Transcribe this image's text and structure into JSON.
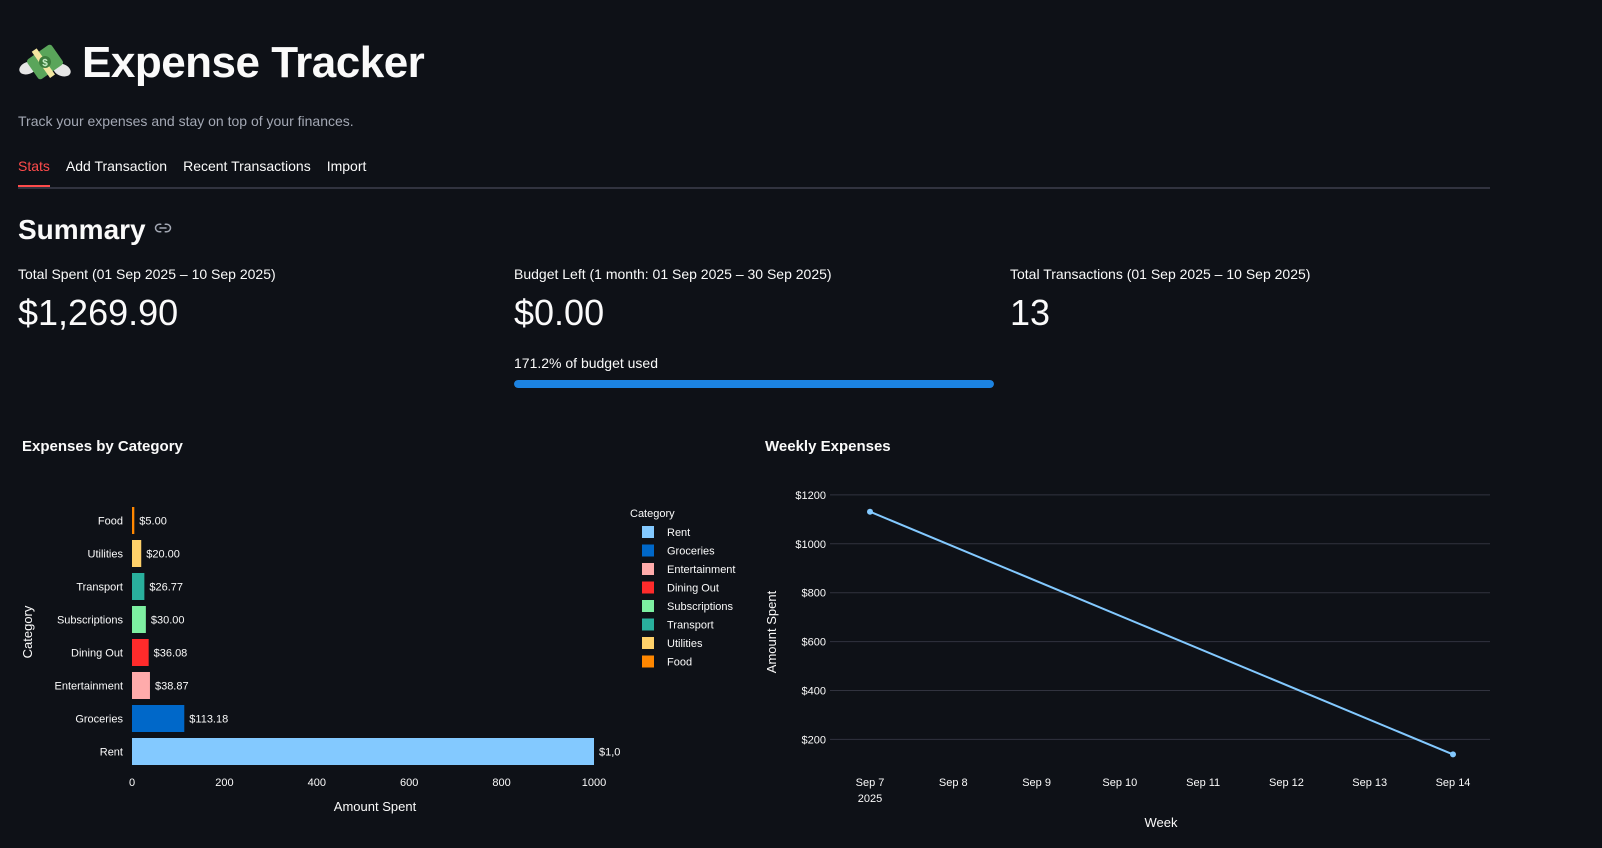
{
  "header": {
    "title": "Expense Tracker",
    "emoji": "money-with-wings-icon",
    "subtitle": "Track your expenses and stay on top of your finances."
  },
  "tabs": [
    {
      "label": "Stats",
      "active": true
    },
    {
      "label": "Add Transaction",
      "active": false
    },
    {
      "label": "Recent Transactions",
      "active": false
    },
    {
      "label": "Import",
      "active": false
    }
  ],
  "summary": {
    "heading": "Summary",
    "total_spent_label": "Total Spent (01 Sep 2025 – 10 Sep 2025)",
    "total_spent_value": "$1,269.90",
    "budget_left_label": "Budget Left (1 month: 01 Sep 2025 – 30 Sep 2025)",
    "budget_left_value": "$0.00",
    "budget_used_text": "171.2% of budget used",
    "budget_progress_fraction": 1.0,
    "total_transactions_label": "Total Transactions (01 Sep 2025 – 10 Sep 2025)",
    "total_transactions_value": "13"
  },
  "colors": {
    "accent": "#ff4b4b",
    "progress": "#1c83e1",
    "line": "#83c9ff"
  },
  "chart_data": [
    {
      "type": "bar",
      "orientation": "horizontal",
      "title": "Expenses by Category",
      "xlabel": "Amount Spent",
      "ylabel": "Category",
      "categories": [
        "Food",
        "Utilities",
        "Transport",
        "Subscriptions",
        "Dining Out",
        "Entertainment",
        "Groceries",
        "Rent"
      ],
      "values": [
        5.0,
        20.0,
        26.77,
        30.0,
        36.08,
        38.87,
        113.18,
        1000.0
      ],
      "data_labels": [
        "$5.00",
        "$20.00",
        "$26.77",
        "$30.00",
        "$36.08",
        "$38.87",
        "$113.18",
        "$1,0"
      ],
      "colors": [
        "#ff8700",
        "#ffd16a",
        "#29b09d",
        "#7defa1",
        "#ff2b2b",
        "#ffabab",
        "#0068c9",
        "#83c9ff"
      ],
      "x_ticks": [
        0,
        200,
        400,
        600,
        800,
        1000
      ],
      "xlim": [
        0,
        1050
      ],
      "legend": {
        "title": "Category",
        "position": "right",
        "entries": [
          "Rent",
          "Groceries",
          "Entertainment",
          "Dining Out",
          "Subscriptions",
          "Transport",
          "Utilities",
          "Food"
        ],
        "colors": [
          "#83c9ff",
          "#0068c9",
          "#ffabab",
          "#ff2b2b",
          "#7defa1",
          "#29b09d",
          "#ffd16a",
          "#ff8700"
        ]
      }
    },
    {
      "type": "line",
      "title": "Weekly Expenses",
      "xlabel": "Week",
      "ylabel": "Amount Spent",
      "x": [
        "2025-09-07",
        "2025-09-14"
      ],
      "y": [
        1131.2,
        138.7
      ],
      "x_ticks": [
        "Sep 7",
        "Sep 8",
        "Sep 9",
        "Sep 10",
        "Sep 11",
        "Sep 12",
        "Sep 13",
        "Sep 14"
      ],
      "x_tick_sub": "2025",
      "y_ticks": [
        "$200",
        "$400",
        "$600",
        "$800",
        "$1000",
        "$1200"
      ],
      "y_tick_values": [
        200,
        400,
        600,
        800,
        1000,
        1200
      ],
      "ylim": [
        75,
        1220
      ],
      "grid": true,
      "color": "#83c9ff"
    }
  ]
}
